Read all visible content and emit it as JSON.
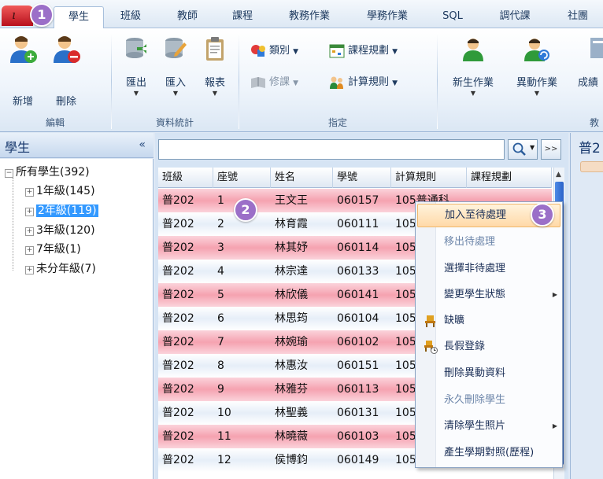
{
  "tabs": [
    {
      "label": "學生",
      "active": true
    },
    {
      "label": "班級"
    },
    {
      "label": "教師"
    },
    {
      "label": "課程"
    },
    {
      "label": "教務作業"
    },
    {
      "label": "學務作業"
    },
    {
      "label": "SQL"
    },
    {
      "label": "調代課"
    },
    {
      "label": "社團"
    }
  ],
  "ribbon": {
    "groups": {
      "edit": "編輯",
      "stats": "資料統計",
      "assign": "指定",
      "teach": "教"
    },
    "buttons": {
      "add": "新增",
      "delete": "刪除",
      "export": "匯出",
      "import": "匯入",
      "report": "報表",
      "new_student_ops": "新生作業",
      "transfer_ops": "異動作業",
      "grades": "成績"
    },
    "small": {
      "category": "類別",
      "course_plan": "課程規劃",
      "elective": "修課",
      "calc_rule": "計算規則"
    }
  },
  "left_panel": {
    "title": "學生",
    "collapse_glyph": "«",
    "tree": {
      "root": "所有學生(392)",
      "children": [
        "1年級(145)",
        "2年級(119)",
        "3年級(120)",
        "7年級(1)",
        "未分年級(7)"
      ],
      "selected_index": 1
    }
  },
  "list": {
    "search_value": "",
    "next_glyph": ">>",
    "columns": [
      "班級",
      "座號",
      "姓名",
      "學號",
      "計算規則",
      "課程規劃"
    ],
    "rows": [
      [
        "普202",
        "1",
        "王文王",
        "060157",
        "105普通科",
        ""
      ],
      [
        "普202",
        "2",
        "林育霞",
        "060111",
        "105",
        ""
      ],
      [
        "普202",
        "3",
        "林其妤",
        "060114",
        "105",
        ""
      ],
      [
        "普202",
        "4",
        "林宗達",
        "060133",
        "105",
        ""
      ],
      [
        "普202",
        "5",
        "林欣儀",
        "060141",
        "105",
        ""
      ],
      [
        "普202",
        "6",
        "林思筠",
        "060104",
        "105",
        ""
      ],
      [
        "普202",
        "7",
        "林婉瑜",
        "060102",
        "105",
        ""
      ],
      [
        "普202",
        "8",
        "林惠汝",
        "060151",
        "105",
        ""
      ],
      [
        "普202",
        "9",
        "林雅芬",
        "060113",
        "105",
        ""
      ],
      [
        "普202",
        "10",
        "林聖義",
        "060131",
        "105",
        ""
      ],
      [
        "普202",
        "11",
        "林曉薇",
        "060103",
        "105",
        ""
      ],
      [
        "普202",
        "12",
        "侯博鈞",
        "060149",
        "105",
        ""
      ]
    ]
  },
  "right_panel": {
    "title": "普2"
  },
  "context_menu": {
    "items": [
      {
        "label": "加入至待處理",
        "state": "hot"
      },
      {
        "label": "移出待處理",
        "state": "disabled"
      },
      {
        "label": "選擇非待處理",
        "state": "normal"
      },
      {
        "label": "變更學生狀態",
        "state": "normal",
        "submenu": true
      },
      {
        "label": "缺曠",
        "state": "normal",
        "icon": "chair-icon"
      },
      {
        "label": "長假登錄",
        "state": "normal",
        "icon": "chair-clock-icon"
      },
      {
        "label": "刪除異動資料",
        "state": "normal"
      },
      {
        "label": "永久刪除學生",
        "state": "disabled"
      },
      {
        "label": "清除學生照片",
        "state": "normal",
        "submenu": true
      },
      {
        "label": "產生學期對照(歷程)",
        "state": "normal"
      }
    ]
  },
  "badges": [
    "1",
    "2",
    "3"
  ],
  "colors": {
    "accent": "#9b6fc8",
    "selection": "#3399ff",
    "row_highlight": "#f5a2b0"
  }
}
